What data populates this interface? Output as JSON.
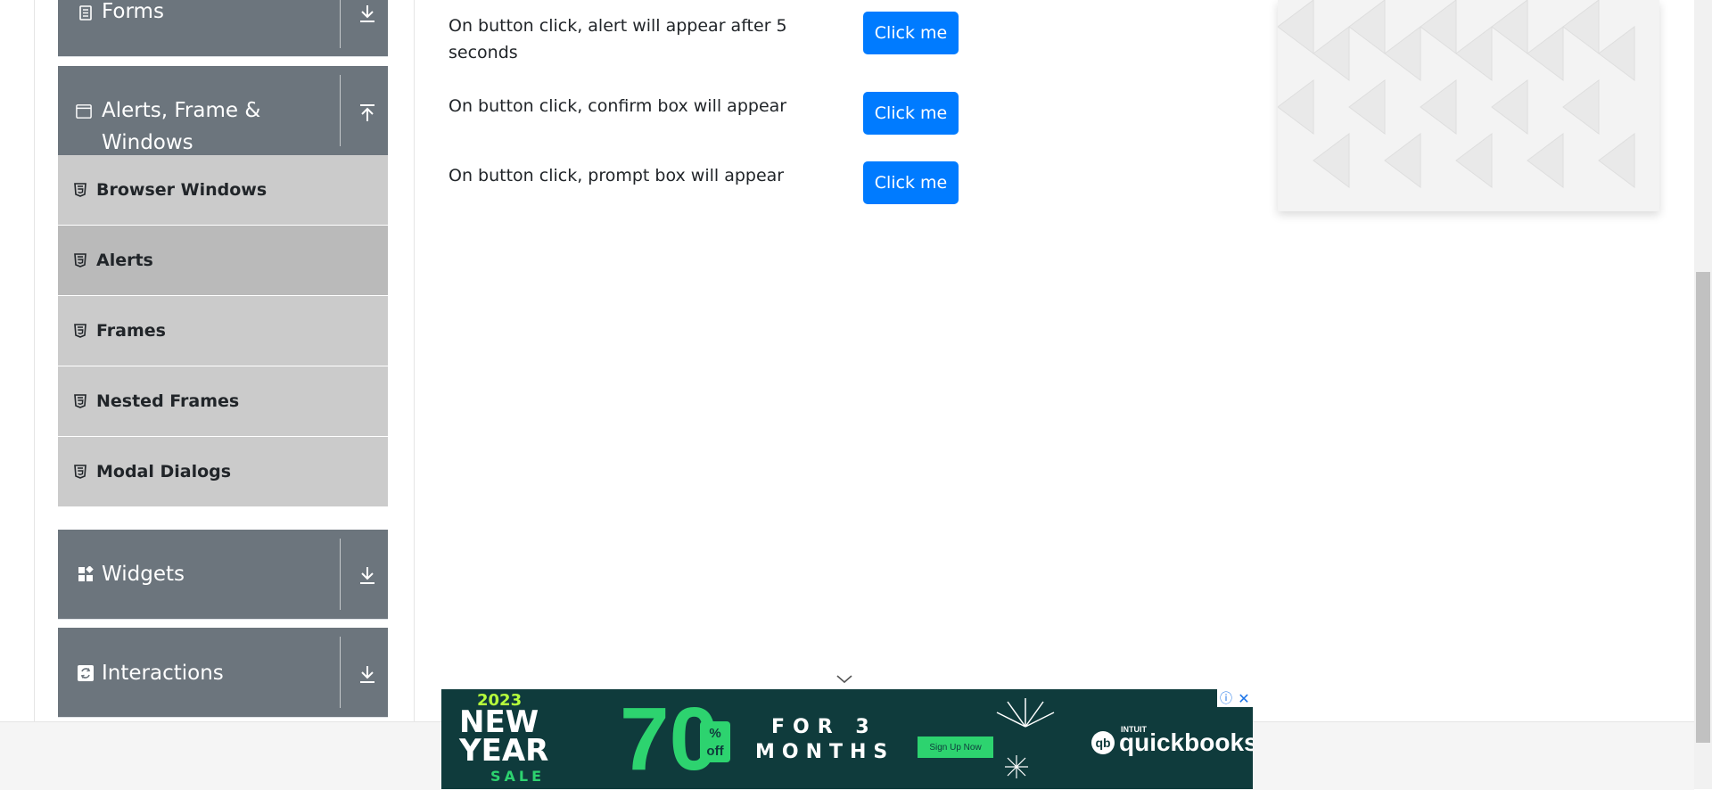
{
  "sidebar": {
    "groups": [
      {
        "title": "Forms",
        "icon": "document-icon",
        "toggle": "download-arrow-icon"
      },
      {
        "title_line1": "Alerts, Frame &",
        "title_line2": "Windows",
        "icon": "window-icon",
        "toggle": "upload-arrow-icon"
      },
      {
        "title": "Widgets",
        "icon": "widgets-grid-icon",
        "toggle": "download-arrow-icon"
      },
      {
        "title": "Interactions",
        "icon": "refresh-square-icon",
        "toggle": "download-arrow-icon"
      }
    ],
    "items": [
      {
        "label": "Browser Windows",
        "active": false
      },
      {
        "label": "Alerts",
        "active": true
      },
      {
        "label": "Frames",
        "active": false
      },
      {
        "label": "Nested Frames",
        "active": false
      },
      {
        "label": "Modal Dialogs",
        "active": false
      }
    ]
  },
  "main": {
    "rows": [
      {
        "text": "On button click, alert will appear after 5 seconds",
        "button": "Click me"
      },
      {
        "text": "On button click, confirm box will appear",
        "button": "Click me"
      },
      {
        "text": "On button click, prompt box will appear",
        "button": "Click me"
      }
    ]
  },
  "ad": {
    "year": "2023",
    "new": "NEW",
    "year_word": "YEAR",
    "sale": "SALE",
    "percent": "70",
    "percent_sign": "%",
    "off": "off",
    "for_text": "FOR 3",
    "months_text": "MONTHS",
    "cta": "Sign Up Now",
    "brand_small": "INTUIT",
    "brand": "quickbooks",
    "info_symbol": "ⓘ",
    "close_symbol": "✕"
  },
  "colors": {
    "sidebar_header": "#6c757d",
    "menu_item": "#cbcbcb",
    "menu_item_active": "#bababa",
    "primary_button": "#007bff",
    "ad_background": "#0f3b3c",
    "ad_accent": "#2dd36f"
  }
}
